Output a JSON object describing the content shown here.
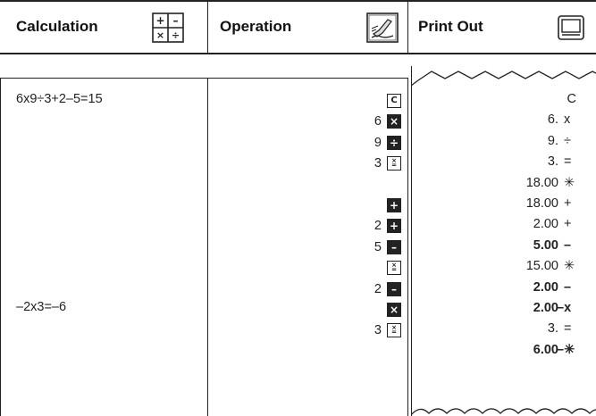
{
  "header": {
    "calculation_label": "Calculation",
    "operation_label": "Operation",
    "printout_label": "Print Out",
    "calculation_icon": "calculator-keys-icon",
    "operation_icon": "hand-writing-icon",
    "printout_icon": "printer-icon"
  },
  "calculations": [
    {
      "text": "6x9÷3+2–5=15"
    },
    {
      "text": "–2x3=–6"
    }
  ],
  "operations": [
    {
      "num": "",
      "key": "C",
      "style": "light"
    },
    {
      "num": "6",
      "key": "×",
      "style": "dark"
    },
    {
      "num": "9",
      "key": "÷",
      "style": "dark"
    },
    {
      "num": "3",
      "key": "=",
      "style": "eq"
    },
    {
      "num": "",
      "key": "",
      "style": "none"
    },
    {
      "num": "",
      "key": "+",
      "style": "dark"
    },
    {
      "num": "2",
      "key": "+",
      "style": "dark"
    },
    {
      "num": "5",
      "key": "–",
      "style": "dark"
    },
    {
      "num": "",
      "key": "=",
      "style": "eq"
    },
    {
      "num": "2",
      "key": "–",
      "style": "dark"
    },
    {
      "num": "",
      "key": "×",
      "style": "dark"
    },
    {
      "num": "3",
      "key": "=",
      "style": "eq"
    },
    {
      "num": "",
      "key": "",
      "style": "none"
    }
  ],
  "printout": [
    {
      "num": "C",
      "sym": "",
      "bold": false
    },
    {
      "num": "6.",
      "sym": "x",
      "bold": false
    },
    {
      "num": "9.",
      "sym": "÷",
      "bold": false
    },
    {
      "num": "3.",
      "sym": "=",
      "bold": false
    },
    {
      "num": "18.00",
      "sym": "✳",
      "bold": false
    },
    {
      "num": "18.00",
      "sym": "+",
      "bold": false
    },
    {
      "num": "2.00",
      "sym": "+",
      "bold": false
    },
    {
      "num": "5.00",
      "sym": "–",
      "bold": true
    },
    {
      "num": "15.00",
      "sym": "✳",
      "bold": false
    },
    {
      "num": "2.00",
      "sym": "–",
      "bold": true
    },
    {
      "num": "2.00",
      "sym": "–x",
      "bold": true
    },
    {
      "num": "3.",
      "sym": "=",
      "bold": false
    },
    {
      "num": "6.00",
      "sym": "–✳",
      "bold": true
    }
  ]
}
